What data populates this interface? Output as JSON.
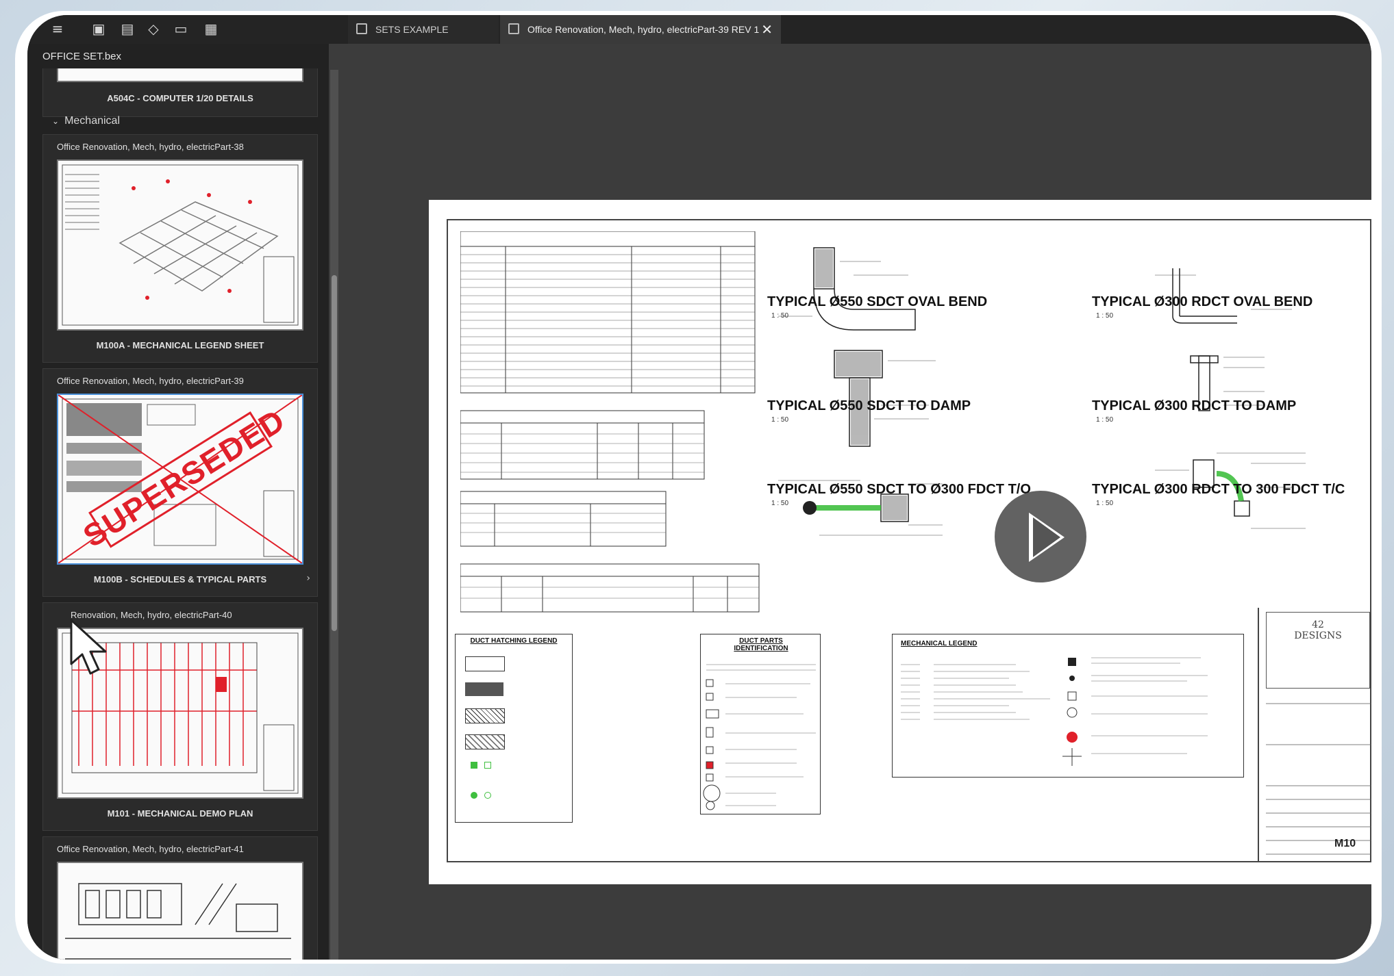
{
  "app": {
    "file_name": "OFFICE SET.bex",
    "tabs": [
      {
        "label": "SETS EXAMPLE"
      },
      {
        "label": "Office Renovation, Mech, hydro, electricPart-39 REV 1"
      }
    ]
  },
  "sidebar": {
    "top_card_label": "A504C - COMPUTER 1/20 DETAILS",
    "section": "Mechanical",
    "cards": [
      {
        "title": "Office Renovation, Mech, hydro, electricPart-38",
        "label": "M100A - MECHANICAL LEGEND SHEET"
      },
      {
        "title": "Office Renovation, Mech, hydro, electricPart-39",
        "label": "M100B - SCHEDULES & TYPICAL PARTS",
        "stamp": "SUPERSEDED"
      },
      {
        "title": "Renovation, Mech, hydro, electricPart-40",
        "label": "M101 - MECHANICAL DEMO PLAN"
      },
      {
        "title": "Office Renovation, Mech, hydro, electricPart-41",
        "label": ""
      }
    ]
  },
  "sheet": {
    "details": [
      {
        "label": "TYPICAL Ø550 SDCT  OVAL BEND",
        "scale": "1 : 50"
      },
      {
        "label": "TYPICAL Ø300 RDCT  OVAL BEND",
        "scale": "1 : 50"
      },
      {
        "label": "TYPICAL Ø550 SDCT TO DAMP",
        "scale": "1 : 50"
      },
      {
        "label": "TYPICAL Ø300 RDCT TO DAMP",
        "scale": "1 : 50"
      },
      {
        "label": "TYPICAL Ø550 SDCT TO Ø300 FDCT T/O",
        "scale": "1 : 50"
      },
      {
        "label": "TYPICAL Ø300 RDCT TO 300 FDCT T/C",
        "scale": "1 : 50"
      }
    ],
    "legends": {
      "duct_hatching": "DUCT HATCHING LEGEND",
      "duct_parts": "DUCT PARTS IDENTIFICATION",
      "mechanical": "MECHANICAL LEGEND"
    },
    "title_block": {
      "logo": "42 DESIGNS",
      "sheet_no": "M10"
    }
  },
  "colors": {
    "accent_red": "#e0202a",
    "duct_green": "#3fbf3f"
  }
}
